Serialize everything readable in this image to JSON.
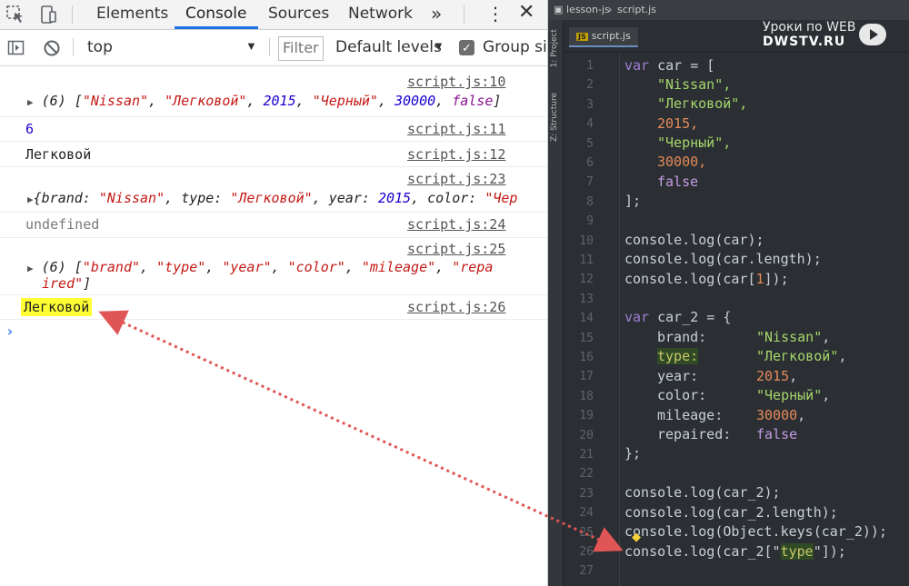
{
  "devtools": {
    "tabs": [
      {
        "label": "Elements"
      },
      {
        "label": "Console"
      },
      {
        "label": "Sources"
      },
      {
        "label": "Network"
      }
    ],
    "more_label": "»",
    "menu_label": "⋮",
    "close_label": "✕",
    "toolbar": {
      "context": "top",
      "filter_placeholder": "Filter",
      "levels": "Default levels",
      "group_label": "Group sir"
    },
    "console": {
      "messages": [
        {
          "source": "script.js:10"
        },
        {
          "source": "script.js:11",
          "text": "6"
        },
        {
          "source": "script.js:12",
          "text": "Легковой"
        },
        {
          "source": "script.js:23"
        },
        {
          "source": "script.js:24",
          "text": "undefined"
        },
        {
          "source": "script.js:25"
        },
        {
          "source": "script.js:26",
          "text": "Легковой"
        }
      ],
      "array_car": {
        "prefix": "(6) [",
        "v1": "\"Nissan\"",
        "v2": "\"Легковой\"",
        "v3": "2015",
        "v4": "\"Черный\"",
        "v5": "30000",
        "v6": "false",
        "suffix": "]"
      },
      "object_car2": {
        "k1": "brand:",
        "v1": "\"Nissan\"",
        "k2": "type:",
        "v2": "\"Легковой\"",
        "k3": "year:",
        "v3": "2015",
        "k4": "color:",
        "v4": "\"Чер"
      },
      "keys_array": {
        "prefix": "(6) [",
        "v1": "\"brand\"",
        "v2": "\"type\"",
        "v3": "\"year\"",
        "v4": "\"color\"",
        "v5": "\"mileage\"",
        "v6a": "\"repa",
        "v6b": "ired\"",
        "suffix": "]"
      },
      "prompt": "›"
    }
  },
  "editor": {
    "path": {
      "project": "lesson-js",
      "file": "script.js"
    },
    "tab": {
      "badge": "JS",
      "label": "script.js"
    },
    "sidebar": {
      "project": "1: Project",
      "structure": "Z: Structure"
    },
    "watermark": {
      "top": "Уроки по WEB",
      "bottom": "DWSTV.RU"
    },
    "line_numbers": [
      "1",
      "2",
      "3",
      "4",
      "5",
      "6",
      "7",
      "8",
      "9",
      "10",
      "11",
      "12",
      "13",
      "14",
      "15",
      "16",
      "17",
      "18",
      "19",
      "20",
      "21",
      "22",
      "23",
      "24",
      "25",
      "26",
      "27"
    ],
    "code": {
      "l1_kw": "var",
      "l1_rest": " car = [",
      "l2": "\"Nissan\",",
      "l3": "\"Легковой\",",
      "l4": "2015,",
      "l5": "\"Черный\",",
      "l6": "30000,",
      "l7": "false",
      "l8": "];",
      "l10": "console.log(car);",
      "l11": "console.log(car.length);",
      "l12a": "console.log(car[",
      "l12n": "1",
      "l12b": "]);",
      "l14_kw": "var",
      "l14_rest": " car_2 = {",
      "l15k": "brand:",
      "l15v": "\"Nissan\"",
      "l15c": ",",
      "l16k": "type:",
      "l16v": "\"Легковой\"",
      "l16c": ",",
      "l17k": "year:",
      "l17v": "2015",
      "l17c": ",",
      "l18k": "color:",
      "l18v": "\"Черный\"",
      "l18c": ",",
      "l19k": "mileage:",
      "l19v": "30000",
      "l19c": ",",
      "l20k": "repaired:",
      "l20v": "false",
      "l21": "};",
      "l23": "console.log(car_2);",
      "l24": "console.log(car_2.length);",
      "l25": "console.log(Object.keys(car_2));",
      "l26a": "console.log(car_2[\"",
      "l26t": "type",
      "l26b": "\"]);"
    }
  },
  "colors": {
    "accent": "#1a73e8",
    "highlight": "#ffff33",
    "arrow": "#e05555"
  }
}
